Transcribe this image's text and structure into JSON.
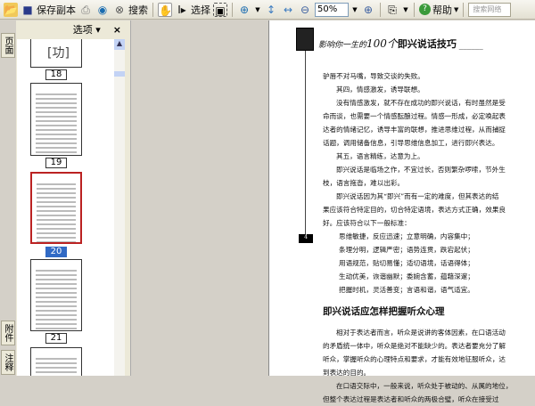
{
  "toolbar": {
    "save_copy": "保存副本",
    "search": "搜索",
    "select": "选择",
    "zoom": "50%",
    "help": "帮助",
    "search_placeholder": "搜索网络"
  },
  "panel": {
    "options": "选项",
    "close": "×",
    "tabs": [
      "页面",
      "附件",
      "注释"
    ]
  },
  "thumbnails": [
    {
      "label": "18"
    },
    {
      "label": "19"
    },
    {
      "label": "20",
      "selected": true
    },
    {
      "label": "21"
    }
  ],
  "page": {
    "header_prefix": "影响你一生的",
    "header_number": "100个",
    "header_title": "即兴说话技巧",
    "page_number": "4",
    "lines": [
      "驴唇不对马嘴，导致交谈的失败。",
      "其四，情感激发，诱导联想。",
      "没有情感激发，就不存在成功的即兴说话，有时虽然是受",
      "命而谈，也需要一个情感酝酿过程。情感一形成，必定唤起表",
      "达者的情绪记忆，诱导丰富的联想，推进思维过程，从而捕捉",
      "话题，调用储备信息，引导思维信息加工，进行即兴表达。",
      "其五，语言精练，达意为上。",
      "即兴说话是临场之作，不宜过长，否则繁杂啰嗦，节外生",
      "枝，语言拖沓，难以出彩。",
      "即兴说话因为其“即兴”而有一定的难度，但其表达的结",
      "果应该符合特定目的，切合特定语境，表达方式正确，效果良",
      "好。应该符合以下一般标准："
    ],
    "standards": [
      "思维敏捷，反应迅速；立意明确，内容集中；",
      "条理分明，逻辑严密；语势连贯，跌宕起伏；",
      "用语规范，贴切易懂；适切语境，话语得体；",
      "生动优美，诙谐幽默；委婉含蓄，蕴藉深邃；",
      "把握时机，灵活善变；言语和谐，语气适宜。"
    ],
    "section_title": "即兴说话应怎样把握听众心理",
    "section_lines": [
      "相对于表达者而言，听众是说讲的客体因素，在口语活动",
      "的矛盾统一体中，听众是绝对不能缺少的。表达者要充分了解",
      "听众，掌握听众的心理特点和要求，才能有效地征服听众，达",
      "到表达的目的。",
      "在口语交际中，一般来说，听众处于被动的、从属的地位，",
      "但整个表达过程是表达者和听众的两极合璧，听众在接受过"
    ]
  }
}
